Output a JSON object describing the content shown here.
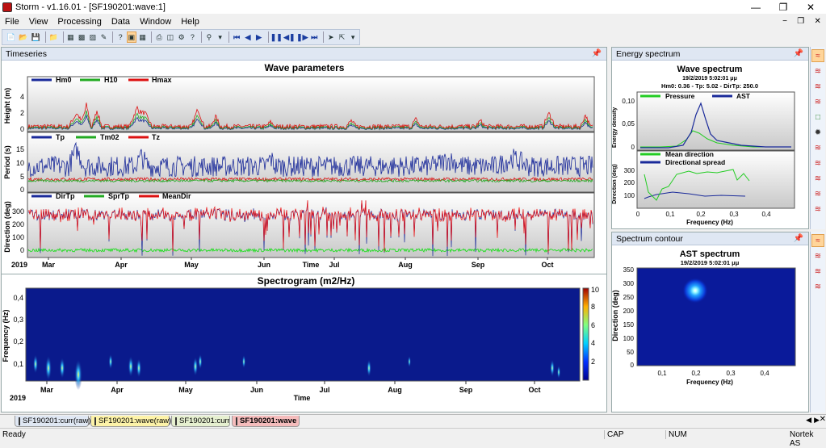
{
  "window": {
    "title": "Storm - v1.16.01 - [SF190201:wave:1]"
  },
  "menu": [
    "File",
    "View",
    "Processing",
    "Data",
    "Window",
    "Help"
  ],
  "panes": {
    "timeseries": "Timeseries",
    "energy": "Energy spectrum",
    "contour": "Spectrum contour"
  },
  "wave": {
    "title": "Wave parameters",
    "height": {
      "ylabel": "Height (m)",
      "ticks": [
        "4",
        "2",
        "0"
      ],
      "legend": [
        "Hm0",
        "H10",
        "Hmax"
      ]
    },
    "period": {
      "ylabel": "Period (s)",
      "ticks": [
        "15",
        "10",
        "5",
        "0"
      ],
      "legend": [
        "Tp",
        "Tm02",
        "Tz"
      ]
    },
    "direction": {
      "ylabel": "Direction (deg)",
      "ticks": [
        "300",
        "200",
        "100",
        "0"
      ],
      "legend": [
        "DirTp",
        "SprTp",
        "MeanDir"
      ]
    },
    "year": "2019",
    "xlabel": "Time",
    "months": [
      "Mar",
      "Apr",
      "May",
      "Jun",
      "Jul",
      "Aug",
      "Sep",
      "Oct"
    ]
  },
  "spectrogram": {
    "title": "Spectrogram (m2/Hz)",
    "ylabel": "Frequency (Hz)",
    "yticks": [
      "0,4",
      "0,3",
      "0,2",
      "0,1"
    ],
    "colorbar": [
      "10",
      "8",
      "6",
      "4",
      "2"
    ],
    "year": "2019",
    "xlabel": "Time",
    "months": [
      "Mar",
      "Apr",
      "May",
      "Jun",
      "Jul",
      "Aug",
      "Sep",
      "Oct"
    ]
  },
  "energy": {
    "title": "Wave spectrum",
    "date": "19/2/2019 5:02:01 μμ",
    "params": "Hm0: 0.36  -  Tp: 5.02  -  DirTp: 250.0",
    "ylabel1": "Energy density",
    "yticks1": [
      "0,10",
      "0,05",
      "0"
    ],
    "legend1": [
      "Pressure",
      "AST"
    ],
    "ylabel2": "Direction (deg)",
    "yticks2": [
      "300",
      "200",
      "100"
    ],
    "legend2": [
      "Mean direction",
      "Directional spread"
    ],
    "xticks": [
      "0",
      "0,1",
      "0,2",
      "0,3",
      "0,4"
    ],
    "xlabel": "Frequency (Hz)"
  },
  "contour": {
    "title": "AST spectrum",
    "date": "19/2/2019 5:02:01 μμ",
    "ylabel": "Direction (deg)",
    "yticks": [
      "350",
      "300",
      "250",
      "200",
      "150",
      "100",
      "50",
      "0"
    ],
    "xticks": [
      "0,1",
      "0,2",
      "0,3",
      "0,4"
    ],
    "xlabel": "Frequency (Hz)"
  },
  "tabs": [
    "SF190201:curr(raw)",
    "SF190201:wave(raw)",
    "SF190201:curr",
    "SF190201:wave"
  ],
  "status": {
    "ready": "Ready",
    "cap": "CAP",
    "num": "NUM",
    "company": "Nortek AS"
  },
  "colors": {
    "hm0": "#1a2a9a",
    "h10": "#22aa22",
    "hmax": "#dd1111",
    "accent": "#dfe7f3"
  }
}
